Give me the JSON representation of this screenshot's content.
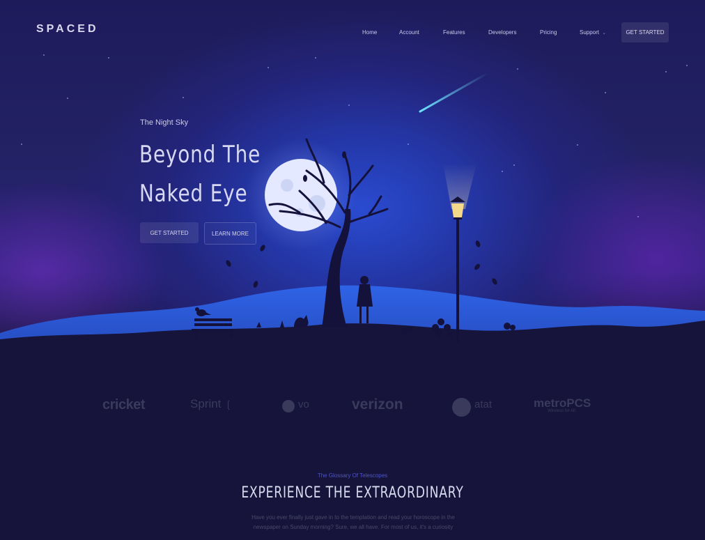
{
  "brand": {
    "logo_text": "SPACED"
  },
  "nav": {
    "items": [
      {
        "label": "Home"
      },
      {
        "label": "Account"
      },
      {
        "label": "Features"
      },
      {
        "label": "Developers"
      },
      {
        "label": "Pricing"
      },
      {
        "label": "Support"
      }
    ],
    "support_chevron": "chevron-down-icon",
    "cta_label": "GET STARTED"
  },
  "hero": {
    "eyebrow": "The Night Sky",
    "headline_line1": "Beyond The",
    "headline_line2": "Naked Eye",
    "primary_button": "GET STARTED",
    "secondary_button": "LEARN MORE"
  },
  "partners": {
    "cricket": "cricket",
    "sprint": "Sprint",
    "vo": "vo",
    "verizon": "verizon",
    "att": "atat",
    "metro": "metroPCS",
    "metro_sub": "Wireless for All."
  },
  "section": {
    "eyebrow": "The Glossary Of Telescopes",
    "title": "EXPERIENCE THE EXTRAORDINARY",
    "body": "Have you ever finally just gave in to the temptation and read your horoscope in the newspaper on Sunday morning? Sure, we all have. For most of us, it's a curiosity"
  },
  "colors": {
    "background": "#141232",
    "sky_blue": "#2a4bd0",
    "accent_text": "#4e56c8",
    "headline": "#d7d9f2"
  },
  "icons": [
    "moon-icon",
    "tree-icon",
    "lamp-post-icon",
    "bench-icon",
    "bird-icon",
    "shooting-star-icon",
    "girl-silhouette-icon"
  ]
}
